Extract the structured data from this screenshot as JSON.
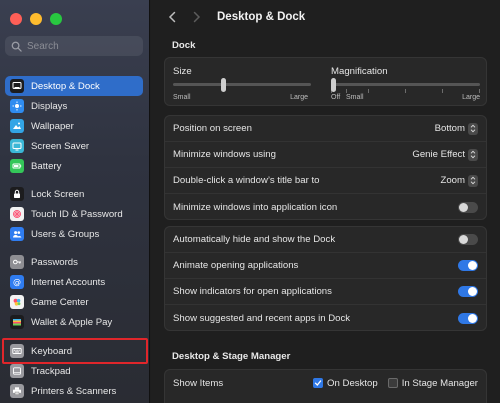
{
  "sidebar": {
    "search_placeholder": "Search",
    "items": [
      {
        "label": "Desktop & Dock",
        "icon": "desktop-dock-icon",
        "color": "#1c1c1e",
        "selected": true
      },
      {
        "label": "Displays",
        "icon": "displays-icon",
        "color": "#2f8cf0"
      },
      {
        "label": "Wallpaper",
        "icon": "wallpaper-icon",
        "color": "#33a5e6"
      },
      {
        "label": "Screen Saver",
        "icon": "screen-saver-icon",
        "color": "#3bb7d6"
      },
      {
        "label": "Battery",
        "icon": "battery-icon",
        "color": "#34c759"
      },
      {
        "label": "Lock Screen",
        "icon": "lock-icon",
        "color": "#1c1c1e"
      },
      {
        "label": "Touch ID & Password",
        "icon": "fingerprint-icon",
        "color": "#f2f2f2"
      },
      {
        "label": "Users & Groups",
        "icon": "users-icon",
        "color": "#2f7cf0"
      },
      {
        "label": "Passwords",
        "icon": "key-icon",
        "color": "#8e8e93"
      },
      {
        "label": "Internet Accounts",
        "icon": "at-icon",
        "color": "#2f7cf0"
      },
      {
        "label": "Game Center",
        "icon": "game-center-icon",
        "color": "#f2f2f2"
      },
      {
        "label": "Wallet & Apple Pay",
        "icon": "wallet-icon",
        "color": "#1c1c1e"
      },
      {
        "label": "Keyboard",
        "icon": "keyboard-icon",
        "color": "#9a9a9f"
      },
      {
        "label": "Trackpad",
        "icon": "trackpad-icon",
        "color": "#9a9a9f"
      },
      {
        "label": "Printers & Scanners",
        "icon": "printer-icon",
        "color": "#9a9a9f"
      }
    ]
  },
  "header": {
    "title": "Desktop & Dock"
  },
  "dock": {
    "section_title": "Dock",
    "size_label": "Size",
    "size_min": "Small",
    "size_max": "Large",
    "size_value": 0.36,
    "mag_label": "Magnification",
    "mag_off": "Off",
    "mag_min": "Small",
    "mag_max": "Large",
    "mag_value": 0.0,
    "position_label": "Position on screen",
    "position_value": "Bottom",
    "minimize_label": "Minimize windows using",
    "minimize_value": "Genie Effect",
    "doubleclick_label": "Double-click a window’s title bar to",
    "doubleclick_value": "Zoom",
    "minimize_into_icon_label": "Minimize windows into application icon",
    "minimize_into_icon_on": false,
    "autohide_label": "Automatically hide and show the Dock",
    "autohide_on": false,
    "animate_label": "Animate opening applications",
    "animate_on": true,
    "indicators_label": "Show indicators for open applications",
    "indicators_on": true,
    "suggested_label": "Show suggested and recent apps in Dock",
    "suggested_on": true
  },
  "stage": {
    "section_title": "Desktop & Stage Manager",
    "show_items_label": "Show Items",
    "on_desktop_label": "On Desktop",
    "on_desktop_checked": true,
    "in_stage_label": "In Stage Manager",
    "in_stage_checked": false
  },
  "colors": {
    "accent": "#2f78e6",
    "selection": "#2f6dc9",
    "highlight_box": "#e0262b"
  }
}
